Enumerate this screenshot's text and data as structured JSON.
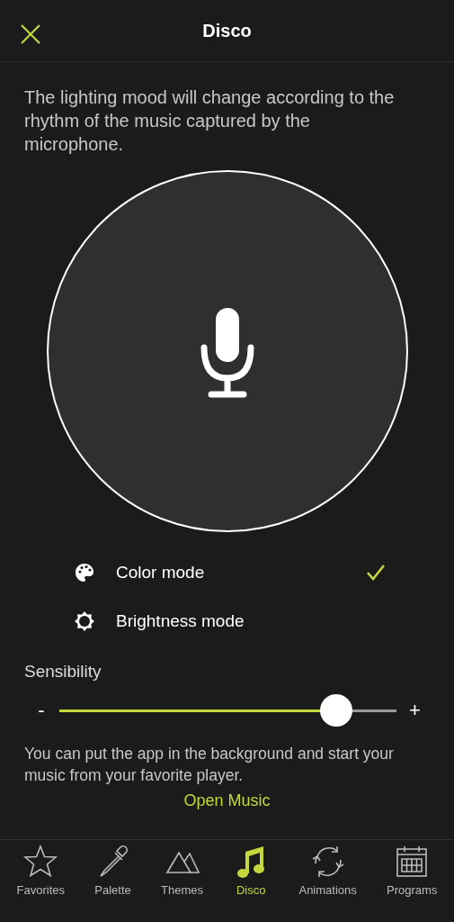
{
  "header": {
    "title": "Disco"
  },
  "description": "The lighting mood will change according to the rhythm of the music captured by the microphone.",
  "modes": [
    {
      "label": "Color mode",
      "selected": true
    },
    {
      "label": "Brightness mode",
      "selected": false
    }
  ],
  "sensibility": {
    "label": "Sensibility",
    "minus": "-",
    "plus": "+",
    "level": 0.82
  },
  "hint": "You can put the app in the background and start your music from your favorite player.",
  "open_music": "Open Music",
  "tabs": [
    {
      "label": "Favorites",
      "selected": false
    },
    {
      "label": "Palette",
      "selected": false
    },
    {
      "label": "Themes",
      "selected": false
    },
    {
      "label": "Disco",
      "selected": true
    },
    {
      "label": "Animations",
      "selected": false
    },
    {
      "label": "Programs",
      "selected": false
    }
  ]
}
